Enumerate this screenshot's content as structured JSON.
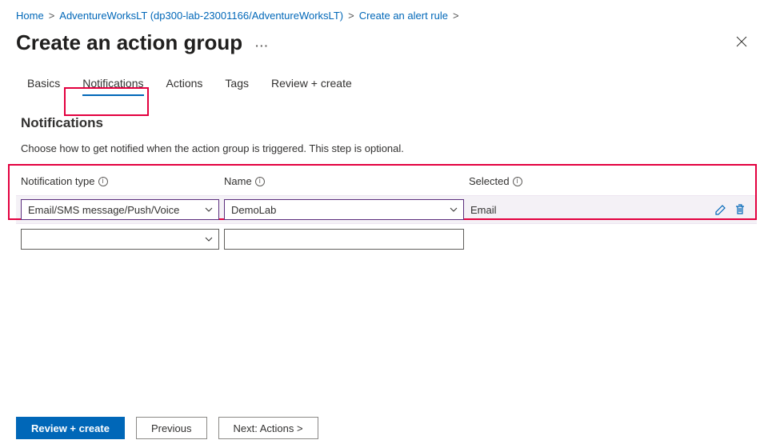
{
  "breadcrumb": {
    "item0": "Home",
    "item1": "AdventureWorksLT (dp300-lab-23001166/AdventureWorksLT)",
    "item2": "Create an alert rule",
    "sep": ">"
  },
  "header": {
    "title": "Create an action group",
    "dots": "···"
  },
  "tabs": {
    "t0": "Basics",
    "t1": "Notifications",
    "t2": "Actions",
    "t3": "Tags",
    "t4": "Review + create"
  },
  "section": {
    "heading": "Notifications",
    "desc": "Choose how to get notified when the action group is triggered. This step is optional."
  },
  "columns": {
    "c0": "Notification type",
    "c1": "Name",
    "c2": "Selected"
  },
  "rows": {
    "r0": {
      "type": "Email/SMS message/Push/Voice",
      "name": "DemoLab",
      "selected": "Email"
    },
    "r1": {
      "type": "",
      "name": "",
      "selected": ""
    }
  },
  "footer": {
    "primary": "Review + create",
    "prev": "Previous",
    "next": "Next: Actions >"
  }
}
